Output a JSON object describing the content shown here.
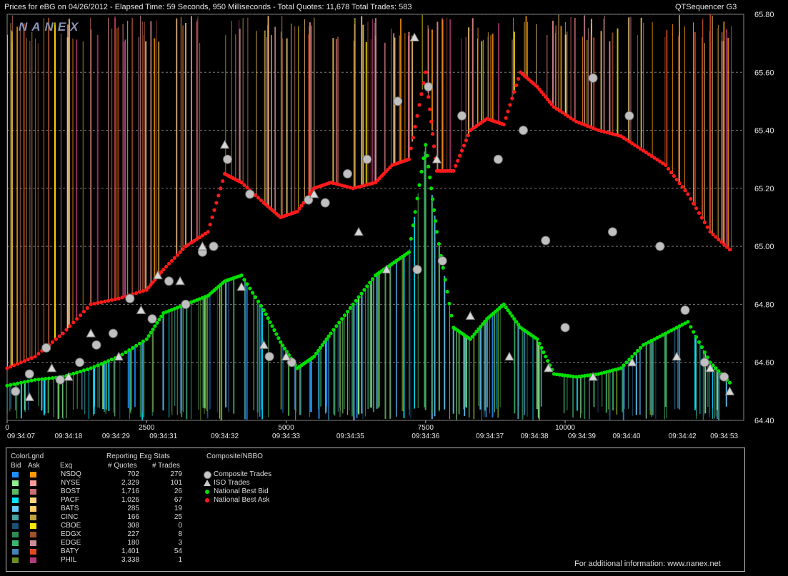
{
  "header": {
    "title": "Prices for  eBG  on  04/26/2012  -  Elapsed Time: 59 Seconds, 950 Milliseconds  -  Total Quotes: 11,678  Total Trades: 583",
    "app_name": "QTSequencer G3"
  },
  "watermark": "NANEX",
  "chart_data": {
    "type": "line",
    "title": "Prices for  eBG  on  04/26/2012",
    "ylim": [
      64.4,
      65.8
    ],
    "y_ticks": [
      "65.80",
      "65.60",
      "65.40",
      "65.20",
      "65.00",
      "64.80",
      "64.60",
      "64.40"
    ],
    "xlim": [
      0,
      12000
    ],
    "x_ticks": [
      "0",
      "2500",
      "5000",
      "7500",
      "10000"
    ],
    "x_tick_values": [
      0,
      2500,
      5000,
      7500,
      10000
    ],
    "time_labels": [
      "09:34:07",
      "09:34:18",
      "09:34:29",
      "09:34:31",
      "09:34:32",
      "09:34:33",
      "09:34:35",
      "09:34:36",
      "09:34:37",
      "09:34:38",
      "09:34:39",
      "09:34:40",
      "09:34:42",
      "09:34:53"
    ],
    "time_label_x": [
      250,
      1100,
      1950,
      2800,
      3900,
      5000,
      6150,
      7500,
      8650,
      9450,
      10300,
      11100,
      12100,
      12850
    ],
    "grid": true,
    "series": [
      {
        "name": "National Best Bid",
        "color": "#00e000",
        "x": [
          0,
          500,
          1000,
          1500,
          2000,
          2500,
          2800,
          3200,
          3600,
          3900,
          4200,
          4600,
          4900,
          5200,
          5500,
          5800,
          6200,
          6600,
          6900,
          7200,
          7500,
          7700,
          8000,
          8300,
          8600,
          8900,
          9200,
          9500,
          9800,
          10200,
          10600,
          11000,
          11400,
          11800,
          12200,
          12600,
          13000
        ],
        "values": [
          64.52,
          64.54,
          64.55,
          64.58,
          64.62,
          64.68,
          64.77,
          64.8,
          64.83,
          64.88,
          64.9,
          64.78,
          64.67,
          64.58,
          64.62,
          64.7,
          64.8,
          64.9,
          64.94,
          64.98,
          65.35,
          65.05,
          64.72,
          64.68,
          64.75,
          64.8,
          64.72,
          64.68,
          64.56,
          64.55,
          64.56,
          64.58,
          64.66,
          64.7,
          64.74,
          64.6,
          64.52
        ]
      },
      {
        "name": "National Best Ask",
        "color": "#ff1a1a",
        "x": [
          0,
          500,
          1000,
          1500,
          2000,
          2500,
          2800,
          3200,
          3600,
          3900,
          4200,
          4600,
          4900,
          5200,
          5500,
          5800,
          6200,
          6600,
          6900,
          7200,
          7500,
          7700,
          8000,
          8300,
          8600,
          8900,
          9200,
          9500,
          9800,
          10200,
          10600,
          11000,
          11400,
          11800,
          12200,
          12600,
          13000
        ],
        "values": [
          64.58,
          64.62,
          64.7,
          64.8,
          64.82,
          64.85,
          64.92,
          65.0,
          65.05,
          65.25,
          65.22,
          65.15,
          65.1,
          65.12,
          65.2,
          65.22,
          65.2,
          65.22,
          65.28,
          65.3,
          65.6,
          65.26,
          65.26,
          65.4,
          65.44,
          65.42,
          65.6,
          65.55,
          65.48,
          65.43,
          65.4,
          65.38,
          65.33,
          65.28,
          65.18,
          65.05,
          64.98
        ]
      },
      {
        "name": "Composite Trades",
        "color": "#c0c0c0",
        "x": [
          150,
          400,
          700,
          950,
          1300,
          1600,
          1900,
          2200,
          2600,
          2900,
          3200,
          3500,
          3700,
          3950,
          4350,
          4700,
          5100,
          5400,
          5700,
          6100,
          6450,
          7000,
          7350,
          7550,
          7800,
          8150,
          8800,
          9250,
          9650,
          10000,
          10500,
          10850,
          11150,
          11700,
          12150,
          12500,
          12850
        ],
        "values": [
          64.5,
          64.56,
          64.65,
          64.54,
          64.6,
          64.66,
          64.7,
          64.82,
          64.75,
          64.88,
          64.8,
          64.98,
          65.0,
          65.3,
          65.18,
          64.62,
          64.6,
          65.16,
          65.15,
          65.25,
          65.3,
          65.5,
          64.92,
          65.55,
          64.95,
          65.45,
          65.3,
          65.4,
          65.02,
          64.72,
          65.58,
          65.05,
          65.45,
          65.0,
          64.78,
          64.6,
          64.55
        ]
      },
      {
        "name": "ISO Trades",
        "color": "#d8d8d8",
        "x": [
          400,
          800,
          1100,
          1500,
          2000,
          2400,
          2700,
          3100,
          3500,
          3900,
          4200,
          4600,
          5000,
          5500,
          6300,
          6800,
          7300,
          7700,
          8300,
          9000,
          9700,
          10500,
          11200,
          12000,
          12600,
          12950
        ],
        "values": [
          64.48,
          64.58,
          64.55,
          64.7,
          64.62,
          64.78,
          64.9,
          64.88,
          65.0,
          65.35,
          64.86,
          64.66,
          64.62,
          65.18,
          65.05,
          64.92,
          65.72,
          65.3,
          64.76,
          64.62,
          64.58,
          64.55,
          64.6,
          64.62,
          64.58,
          64.5
        ]
      }
    ]
  },
  "legend": {
    "color_legend_title": "ColorLgnd",
    "bid_label": "Bid",
    "ask_label": "Ask",
    "exq_label": "Exq",
    "stats_title": "Reporting Exg Stats",
    "quotes_label": "# Quotes",
    "trades_label": "# Trades",
    "composite_title": "Composite/NBBO",
    "composite_items": [
      {
        "label": "Composite Trades",
        "marker": "circle",
        "color": "#c8c8c8"
      },
      {
        "label": "ISO Trades",
        "marker": "triangle",
        "color": "#c8c8c8"
      },
      {
        "label": "National Best Bid",
        "marker": "dot",
        "color": "#00e000"
      },
      {
        "label": "National Best Ask",
        "marker": "dot",
        "color": "#ff1a1a"
      }
    ],
    "exchanges": [
      {
        "name": "NSDQ",
        "bid_color": "#1e90ff",
        "ask_color": "#ff9900",
        "quotes": "702",
        "trades": "279"
      },
      {
        "name": "NYSE",
        "bid_color": "#90ee90",
        "ask_color": "#ff9a9a",
        "quotes": "2,329",
        "trades": "101"
      },
      {
        "name": "BOST",
        "bid_color": "#5cb85c",
        "ask_color": "#c87070",
        "quotes": "1,716",
        "trades": "26"
      },
      {
        "name": "PACF",
        "bid_color": "#00e5ff",
        "ask_color": "#ffd27f",
        "quotes": "1,026",
        "trades": "67"
      },
      {
        "name": "BATS",
        "bid_color": "#66ccff",
        "ask_color": "#ffcc66",
        "quotes": "285",
        "trades": "19"
      },
      {
        "name": "CINC",
        "bid_color": "#4aa3a3",
        "ask_color": "#c0a040",
        "quotes": "166",
        "trades": "25"
      },
      {
        "name": "CBOE",
        "bid_color": "#1a5276",
        "ask_color": "#ffe600",
        "quotes": "308",
        "trades": "0"
      },
      {
        "name": "EDGX",
        "bid_color": "#2e8b57",
        "ask_color": "#a0522d",
        "quotes": "227",
        "trades": "8"
      },
      {
        "name": "EDGE",
        "bid_color": "#3cb371",
        "ask_color": "#cd8c95",
        "quotes": "180",
        "trades": "3"
      },
      {
        "name": "BATY",
        "bid_color": "#4682b4",
        "ask_color": "#e04b1a",
        "quotes": "1,401",
        "trades": "54"
      },
      {
        "name": "PHIL",
        "bid_color": "#6b8e23",
        "ask_color": "#b03a7a",
        "quotes": "3,338",
        "trades": "1"
      }
    ]
  },
  "footer": {
    "info": "For additional information: www.nanex.net"
  },
  "colors": {
    "background": "#000000",
    "grid": "#7a7a7a",
    "text": "#e6e6e6"
  }
}
